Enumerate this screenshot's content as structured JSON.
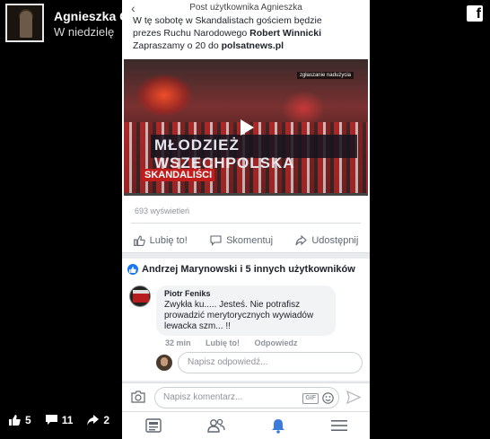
{
  "story": {
    "author": "Agnieszka Gozdyra",
    "time": "W niedzielę",
    "counts": {
      "likes": "5",
      "comments": "11",
      "shares": "2"
    }
  },
  "phone": {
    "nav_title": "Post użytkownika Agnieszka",
    "post": {
      "line1": "W tę sobotę w Skandalistach gościem będzie",
      "line2_prefix": "prezes Ruchu Narodowego ",
      "line2_bold": "Robert Winnicki",
      "line3_prefix": "Zapraszamy o 20 do ",
      "line3_bold": "polsatnews.pl",
      "video_banner": "MŁODZIEŻ WSZECHPOLSKA",
      "video_tag": "zgłaszanie nadużycia",
      "video_logo": "SKANDALIŚCI",
      "views": "693 wyświetleń"
    },
    "actions": {
      "like": "Lubię to!",
      "comment": "Skomentuj",
      "share": "Udostępnij"
    },
    "likes_text": "Andrzej Marynowski i 5 innych użytkowników",
    "comment": {
      "author": "Piotr Feniks",
      "text": "Zwykła ku..... Jesteś.  Nie potrafisz prowadzić merytorycznych wywiadów lewacka szm... !!",
      "time": "32 min",
      "like": "Lubię to!",
      "reply": "Odpowiedz"
    },
    "reply_placeholder": "Napisz odpowiedź...",
    "comment_placeholder": "Napisz komentarz...",
    "gif_label": "GIF"
  },
  "colors": {
    "brand_blue": "#1877f2",
    "notification_blue": "#3b7bdc"
  }
}
